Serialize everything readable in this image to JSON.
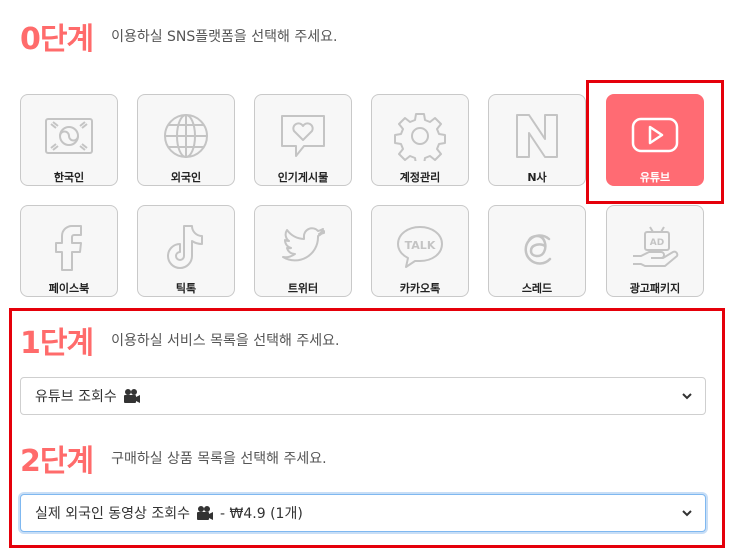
{
  "step0": {
    "num": "0단계",
    "desc": "이용하실 SNS플랫폼을 선택해 주세요."
  },
  "tiles": [
    {
      "label": "한국인",
      "icon": "korea-flag-icon"
    },
    {
      "label": "외국인",
      "icon": "globe-icon"
    },
    {
      "label": "인기게시물",
      "icon": "heart-chat-icon"
    },
    {
      "label": "계정관리",
      "icon": "gear-icon"
    },
    {
      "label": "N사",
      "icon": "naver-n-icon"
    },
    {
      "label": "유튜브",
      "icon": "youtube-play-icon",
      "selected": true
    },
    {
      "label": "페이스북",
      "icon": "facebook-icon"
    },
    {
      "label": "틱톡",
      "icon": "tiktok-icon"
    },
    {
      "label": "트위터",
      "icon": "twitter-bird-icon"
    },
    {
      "label": "카카오톡",
      "icon": "kakaotalk-icon"
    },
    {
      "label": "스레드",
      "icon": "threads-icon"
    },
    {
      "label": "광고패키지",
      "icon": "ad-package-icon"
    }
  ],
  "step1": {
    "num": "1단계",
    "desc": "이용하실 서비스 목록을 선택해 주세요.",
    "select_value": "유튜브 조회수"
  },
  "step2": {
    "num": "2단계",
    "desc": "구매하실 상품 목록을 선택해 주세요.",
    "select_value_prefix": "실제 외국인 동영상 조회수",
    "select_value_suffix": "- ₩4.9 (1개)"
  },
  "colors": {
    "accent": "#ff6b6b",
    "selected_tile": "#ff6b73",
    "highlight_box": "#e5000a"
  }
}
